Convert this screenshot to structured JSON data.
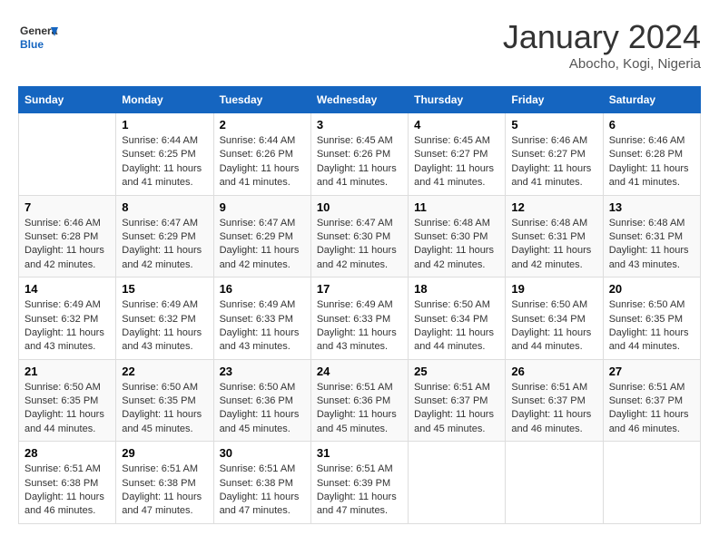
{
  "logo": {
    "line1": "General",
    "line2": "Blue"
  },
  "title": "January 2024",
  "location": "Abocho, Kogi, Nigeria",
  "days_of_week": [
    "Sunday",
    "Monday",
    "Tuesday",
    "Wednesday",
    "Thursday",
    "Friday",
    "Saturday"
  ],
  "weeks": [
    [
      {
        "day": "",
        "sunrise": "",
        "sunset": "",
        "daylight": ""
      },
      {
        "day": "1",
        "sunrise": "Sunrise: 6:44 AM",
        "sunset": "Sunset: 6:25 PM",
        "daylight": "Daylight: 11 hours and 41 minutes."
      },
      {
        "day": "2",
        "sunrise": "Sunrise: 6:44 AM",
        "sunset": "Sunset: 6:26 PM",
        "daylight": "Daylight: 11 hours and 41 minutes."
      },
      {
        "day": "3",
        "sunrise": "Sunrise: 6:45 AM",
        "sunset": "Sunset: 6:26 PM",
        "daylight": "Daylight: 11 hours and 41 minutes."
      },
      {
        "day": "4",
        "sunrise": "Sunrise: 6:45 AM",
        "sunset": "Sunset: 6:27 PM",
        "daylight": "Daylight: 11 hours and 41 minutes."
      },
      {
        "day": "5",
        "sunrise": "Sunrise: 6:46 AM",
        "sunset": "Sunset: 6:27 PM",
        "daylight": "Daylight: 11 hours and 41 minutes."
      },
      {
        "day": "6",
        "sunrise": "Sunrise: 6:46 AM",
        "sunset": "Sunset: 6:28 PM",
        "daylight": "Daylight: 11 hours and 41 minutes."
      }
    ],
    [
      {
        "day": "7",
        "sunrise": "Sunrise: 6:46 AM",
        "sunset": "Sunset: 6:28 PM",
        "daylight": "Daylight: 11 hours and 42 minutes."
      },
      {
        "day": "8",
        "sunrise": "Sunrise: 6:47 AM",
        "sunset": "Sunset: 6:29 PM",
        "daylight": "Daylight: 11 hours and 42 minutes."
      },
      {
        "day": "9",
        "sunrise": "Sunrise: 6:47 AM",
        "sunset": "Sunset: 6:29 PM",
        "daylight": "Daylight: 11 hours and 42 minutes."
      },
      {
        "day": "10",
        "sunrise": "Sunrise: 6:47 AM",
        "sunset": "Sunset: 6:30 PM",
        "daylight": "Daylight: 11 hours and 42 minutes."
      },
      {
        "day": "11",
        "sunrise": "Sunrise: 6:48 AM",
        "sunset": "Sunset: 6:30 PM",
        "daylight": "Daylight: 11 hours and 42 minutes."
      },
      {
        "day": "12",
        "sunrise": "Sunrise: 6:48 AM",
        "sunset": "Sunset: 6:31 PM",
        "daylight": "Daylight: 11 hours and 42 minutes."
      },
      {
        "day": "13",
        "sunrise": "Sunrise: 6:48 AM",
        "sunset": "Sunset: 6:31 PM",
        "daylight": "Daylight: 11 hours and 43 minutes."
      }
    ],
    [
      {
        "day": "14",
        "sunrise": "Sunrise: 6:49 AM",
        "sunset": "Sunset: 6:32 PM",
        "daylight": "Daylight: 11 hours and 43 minutes."
      },
      {
        "day": "15",
        "sunrise": "Sunrise: 6:49 AM",
        "sunset": "Sunset: 6:32 PM",
        "daylight": "Daylight: 11 hours and 43 minutes."
      },
      {
        "day": "16",
        "sunrise": "Sunrise: 6:49 AM",
        "sunset": "Sunset: 6:33 PM",
        "daylight": "Daylight: 11 hours and 43 minutes."
      },
      {
        "day": "17",
        "sunrise": "Sunrise: 6:49 AM",
        "sunset": "Sunset: 6:33 PM",
        "daylight": "Daylight: 11 hours and 43 minutes."
      },
      {
        "day": "18",
        "sunrise": "Sunrise: 6:50 AM",
        "sunset": "Sunset: 6:34 PM",
        "daylight": "Daylight: 11 hours and 44 minutes."
      },
      {
        "day": "19",
        "sunrise": "Sunrise: 6:50 AM",
        "sunset": "Sunset: 6:34 PM",
        "daylight": "Daylight: 11 hours and 44 minutes."
      },
      {
        "day": "20",
        "sunrise": "Sunrise: 6:50 AM",
        "sunset": "Sunset: 6:35 PM",
        "daylight": "Daylight: 11 hours and 44 minutes."
      }
    ],
    [
      {
        "day": "21",
        "sunrise": "Sunrise: 6:50 AM",
        "sunset": "Sunset: 6:35 PM",
        "daylight": "Daylight: 11 hours and 44 minutes."
      },
      {
        "day": "22",
        "sunrise": "Sunrise: 6:50 AM",
        "sunset": "Sunset: 6:35 PM",
        "daylight": "Daylight: 11 hours and 45 minutes."
      },
      {
        "day": "23",
        "sunrise": "Sunrise: 6:50 AM",
        "sunset": "Sunset: 6:36 PM",
        "daylight": "Daylight: 11 hours and 45 minutes."
      },
      {
        "day": "24",
        "sunrise": "Sunrise: 6:51 AM",
        "sunset": "Sunset: 6:36 PM",
        "daylight": "Daylight: 11 hours and 45 minutes."
      },
      {
        "day": "25",
        "sunrise": "Sunrise: 6:51 AM",
        "sunset": "Sunset: 6:37 PM",
        "daylight": "Daylight: 11 hours and 45 minutes."
      },
      {
        "day": "26",
        "sunrise": "Sunrise: 6:51 AM",
        "sunset": "Sunset: 6:37 PM",
        "daylight": "Daylight: 11 hours and 46 minutes."
      },
      {
        "day": "27",
        "sunrise": "Sunrise: 6:51 AM",
        "sunset": "Sunset: 6:37 PM",
        "daylight": "Daylight: 11 hours and 46 minutes."
      }
    ],
    [
      {
        "day": "28",
        "sunrise": "Sunrise: 6:51 AM",
        "sunset": "Sunset: 6:38 PM",
        "daylight": "Daylight: 11 hours and 46 minutes."
      },
      {
        "day": "29",
        "sunrise": "Sunrise: 6:51 AM",
        "sunset": "Sunset: 6:38 PM",
        "daylight": "Daylight: 11 hours and 47 minutes."
      },
      {
        "day": "30",
        "sunrise": "Sunrise: 6:51 AM",
        "sunset": "Sunset: 6:38 PM",
        "daylight": "Daylight: 11 hours and 47 minutes."
      },
      {
        "day": "31",
        "sunrise": "Sunrise: 6:51 AM",
        "sunset": "Sunset: 6:39 PM",
        "daylight": "Daylight: 11 hours and 47 minutes."
      },
      {
        "day": "",
        "sunrise": "",
        "sunset": "",
        "daylight": ""
      },
      {
        "day": "",
        "sunrise": "",
        "sunset": "",
        "daylight": ""
      },
      {
        "day": "",
        "sunrise": "",
        "sunset": "",
        "daylight": ""
      }
    ]
  ]
}
